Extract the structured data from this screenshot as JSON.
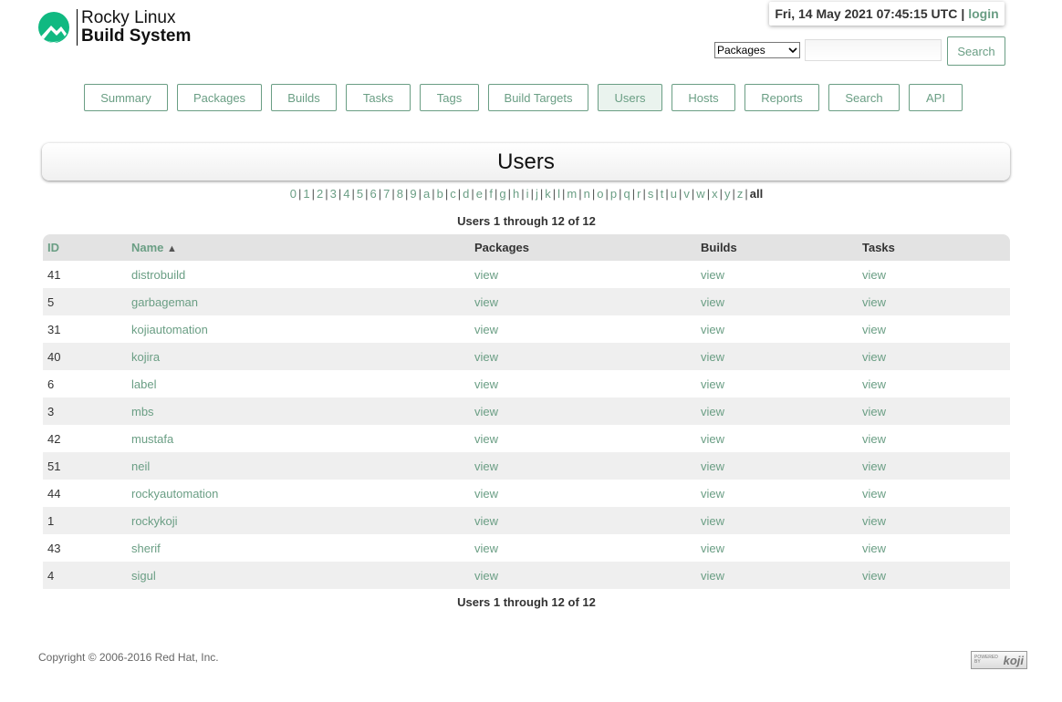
{
  "branding": {
    "line1": "Rocky Linux",
    "line2": "Build System",
    "logo_color": "#10b981"
  },
  "header": {
    "datetime": "Fri, 14 May 2021 07:45:15 UTC",
    "separator": "|",
    "login_label": "login"
  },
  "search": {
    "select_value": "Packages",
    "input_value": "",
    "button_label": "Search"
  },
  "nav": [
    {
      "label": "Summary"
    },
    {
      "label": "Packages"
    },
    {
      "label": "Builds"
    },
    {
      "label": "Tasks"
    },
    {
      "label": "Tags"
    },
    {
      "label": "Build Targets"
    },
    {
      "label": "Users",
      "active": true
    },
    {
      "label": "Hosts"
    },
    {
      "label": "Reports"
    },
    {
      "label": "Search"
    },
    {
      "label": "API"
    }
  ],
  "page_title": "Users",
  "letter_filter": {
    "items": [
      "0",
      "1",
      "2",
      "3",
      "4",
      "5",
      "6",
      "7",
      "8",
      "9",
      "a",
      "b",
      "c",
      "d",
      "e",
      "f",
      "g",
      "h",
      "i",
      "j",
      "k",
      "l",
      "m",
      "n",
      "o",
      "p",
      "q",
      "r",
      "s",
      "t",
      "u",
      "v",
      "w",
      "x",
      "y",
      "z"
    ],
    "current": "all"
  },
  "range_label": "Users 1 through 12 of 12",
  "table": {
    "columns": {
      "id": "ID",
      "name": "Name",
      "sort_indicator": "▲",
      "packages": "Packages",
      "builds": "Builds",
      "tasks": "Tasks"
    },
    "link_label": "view",
    "rows": [
      {
        "id": "41",
        "name": "distrobuild"
      },
      {
        "id": "5",
        "name": "garbageman"
      },
      {
        "id": "31",
        "name": "kojiautomation"
      },
      {
        "id": "40",
        "name": "kojira"
      },
      {
        "id": "6",
        "name": "label"
      },
      {
        "id": "3",
        "name": "mbs"
      },
      {
        "id": "42",
        "name": "mustafa"
      },
      {
        "id": "51",
        "name": "neil"
      },
      {
        "id": "44",
        "name": "rockyautomation"
      },
      {
        "id": "1",
        "name": "rockykoji"
      },
      {
        "id": "43",
        "name": "sherif"
      },
      {
        "id": "4",
        "name": "sigul"
      }
    ]
  },
  "footer": {
    "copyright": "Copyright © 2006-2016 Red Hat, Inc.",
    "badge_small": "POWERED BY",
    "badge_word": "koji"
  },
  "colors": {
    "accent": "#6a9e84",
    "header_row": "#e3e3e3",
    "stripe": "#efefef"
  }
}
